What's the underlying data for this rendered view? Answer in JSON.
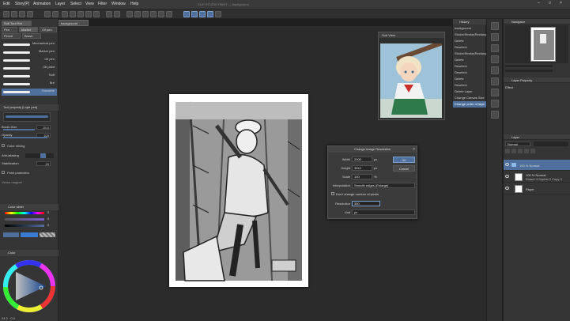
{
  "window_title": "CLIP STUDIO PAINT — background",
  "menu": [
    "Edit",
    "Story(P)",
    "Animation",
    "Layer",
    "Select",
    "View",
    "Filter",
    "Window",
    "Help"
  ],
  "canvas_tab": "background",
  "left_panel": {
    "tabs_top": [
      "Sub Tool Ret",
      "Pen",
      "Marker",
      "Oil pen",
      "Pencil",
      "Brush"
    ],
    "brushes": [
      "Mechanical pen",
      "Marker pen",
      "Oil pen",
      "Oil paint",
      "Soft",
      "Bre",
      "Gouache"
    ],
    "tool_property_title": "Tool property [Lope pen]",
    "brush_size_label": "Brush Size",
    "brush_size_value": "25.0",
    "opacity_label": "Opacity",
    "opacity_value": "100",
    "color_mixing_label": "Color mixing",
    "anti_aliasing_label": "Anti-aliasing",
    "stabilization_label": "Stabilization",
    "stabilization_value": "20",
    "point_protection_label": "Point protection",
    "vector_eraser_label": "Vector magnet",
    "color_slider_title": "Color slider",
    "color_wheel_title": "Color",
    "color_values": [
      "0",
      "0",
      "0"
    ]
  },
  "history": {
    "title": "History",
    "items": [
      "background",
      "Stroke/Stroke(Rectangle)",
      "Delete",
      "Deselect",
      "Stroke/Stroke(Rectangle)",
      "Delete",
      "Deselect",
      "Deselect",
      "Delete",
      "Deselect",
      "Delete Layer",
      "Change Canvas Size",
      "Change order of layer"
    ],
    "selected_index": 12
  },
  "subview": {
    "title": "Sub View"
  },
  "dialog": {
    "title": "Change Image Resolution",
    "width_label": "Width",
    "width_value": "2000",
    "height_label": "Height",
    "height_value": "3510",
    "scale_label": "Scale",
    "scale_value": "100",
    "interpolation_label": "Interpolation",
    "interpolation_value": "Smooth edges (Enlarge)",
    "fixed_pixel_label": "Don't change number of pixels",
    "resolution_label": "Resolution",
    "resolution_value": "350",
    "unit_label": "Unit",
    "unit_value": "px",
    "ok_label": "OK",
    "cancel_label": "Cancel",
    "unit_small": [
      "px",
      "px",
      "%"
    ]
  },
  "navigator": {
    "title": "Navigator"
  },
  "layer_property": {
    "title": "Layer Property",
    "effect_label": "Effect"
  },
  "layers": {
    "title": "Layer",
    "blend_mode": "Normal",
    "rows": [
      {
        "label": "100 % Normal",
        "sub": ""
      },
      {
        "label": "100 % Normal",
        "sub": "Eraser 4 Sophie 2 Copy 3"
      },
      {
        "label": "Paper",
        "sub": ""
      }
    ],
    "selected_index": 0
  },
  "status": {
    "zoom": "24.2",
    "coords": "0.0"
  },
  "colors": {
    "accent": "#4f6f9c",
    "bg": "#2b2b2b",
    "panel": "#353535"
  }
}
